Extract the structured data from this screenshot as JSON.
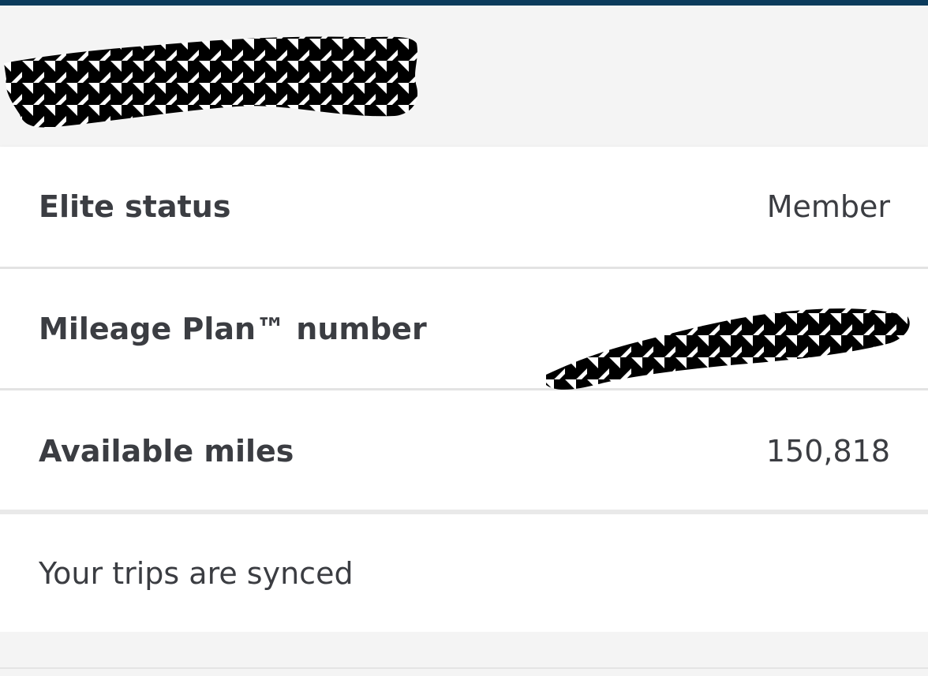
{
  "account": {
    "elite_status_label": "Elite status",
    "elite_status_value": "Member",
    "mileage_plan_label": "Mileage Plan™ number",
    "available_miles_label": "Available miles",
    "available_miles_value": "150,818",
    "sync_status": "Your trips are synced"
  },
  "colors": {
    "top_bar": "#0b3b5c",
    "text": "#3b3d42",
    "background": "#f4f4f4",
    "card": "#ffffff"
  }
}
